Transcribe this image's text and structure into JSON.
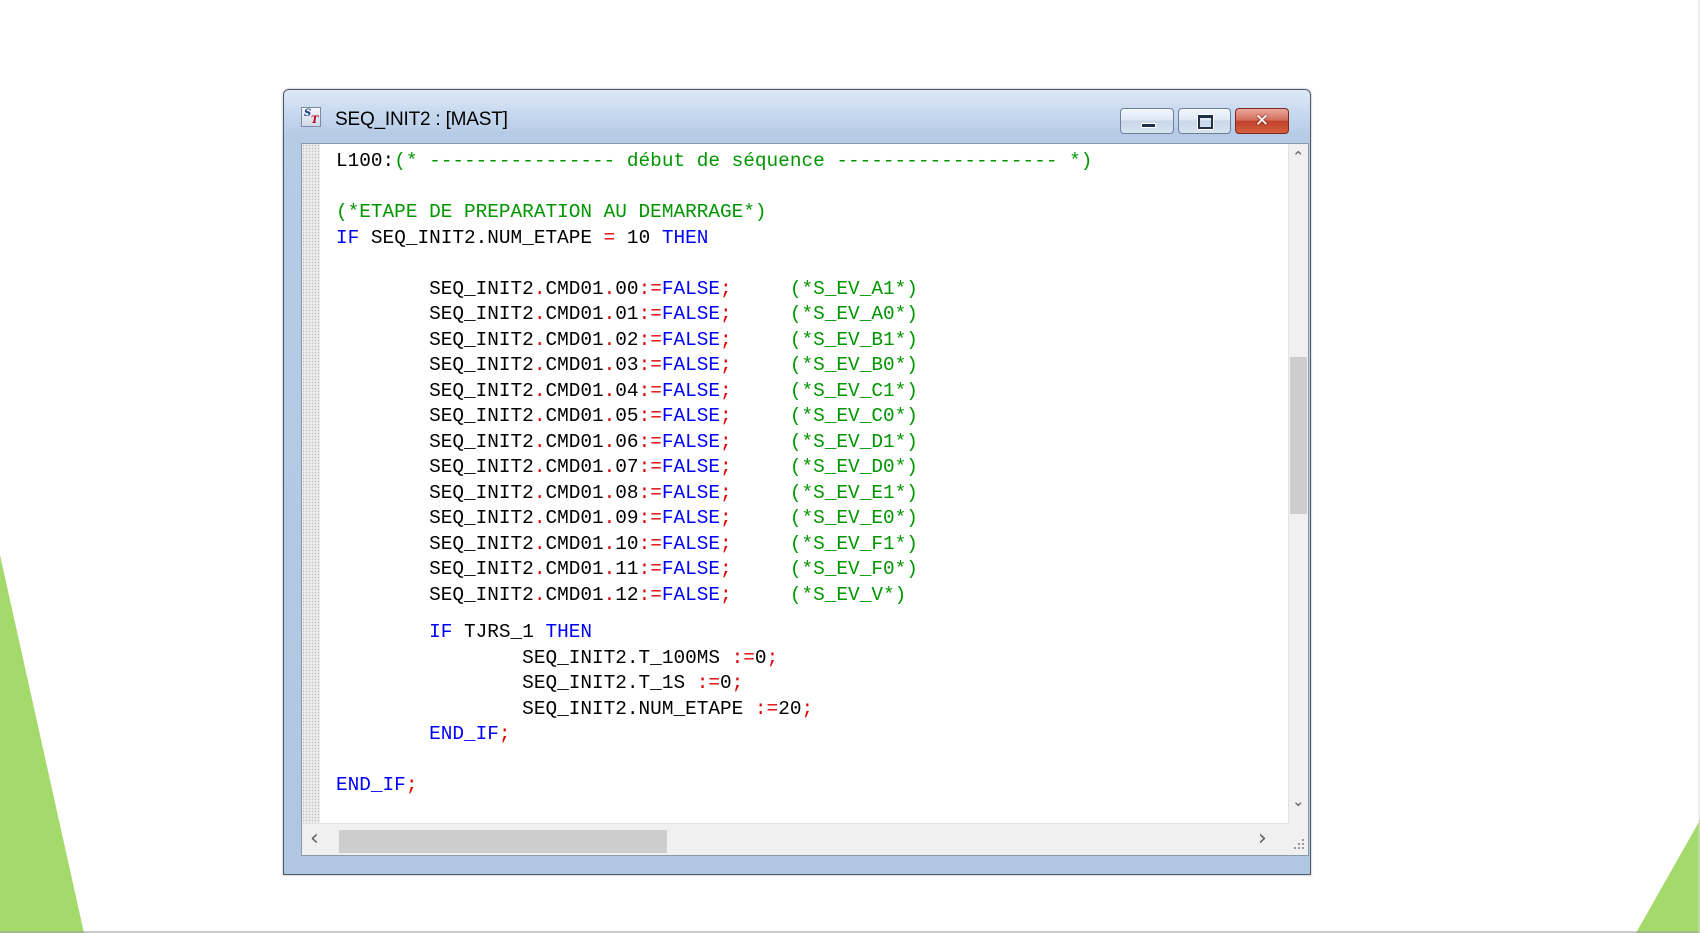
{
  "window": {
    "title": "SEQ_INIT2 : [MAST]",
    "icon": "structured-text-icon",
    "icon_letters": {
      "s": "S",
      "t": "T"
    },
    "controls": {
      "minimize": "minimize-icon",
      "maximize": "maximize-icon",
      "close": "close-icon",
      "close_glyph": "✕"
    }
  },
  "colors": {
    "comment": "#009600",
    "keyword": "#0000ff",
    "operator": "#e00000",
    "slide_accent": "#a4d96b"
  },
  "code": {
    "lines": [
      [
        {
          "t": "L100:",
          "c": ""
        },
        {
          "t": "(* ---------------- début de séquence ------------------- *)",
          "c": "cmt"
        }
      ],
      [],
      [
        {
          "t": "(*ETAPE DE PREPARATION AU DEMARRAGE*)",
          "c": "cmt"
        }
      ],
      [
        {
          "t": "IF",
          "c": "kw"
        },
        {
          "t": " SEQ_INIT2.NUM_ETAPE ",
          "c": ""
        },
        {
          "t": "=",
          "c": "op"
        },
        {
          "t": " 10 ",
          "c": ""
        },
        {
          "t": "THEN",
          "c": "kw"
        }
      ],
      [],
      [
        {
          "t": "        SEQ_INIT2",
          "c": ""
        },
        {
          "t": ".",
          "c": "op"
        },
        {
          "t": "CMD01",
          "c": ""
        },
        {
          "t": ".",
          "c": "op"
        },
        {
          "t": "00",
          "c": ""
        },
        {
          "t": ":=",
          "c": "op"
        },
        {
          "t": "FALSE",
          "c": "kw"
        },
        {
          "t": ";",
          "c": "op"
        },
        {
          "t": "     ",
          "c": ""
        },
        {
          "t": "(*S_EV_A1*)",
          "c": "cmt"
        }
      ],
      [
        {
          "t": "        SEQ_INIT2",
          "c": ""
        },
        {
          "t": ".",
          "c": "op"
        },
        {
          "t": "CMD01",
          "c": ""
        },
        {
          "t": ".",
          "c": "op"
        },
        {
          "t": "01",
          "c": ""
        },
        {
          "t": ":=",
          "c": "op"
        },
        {
          "t": "FALSE",
          "c": "kw"
        },
        {
          "t": ";",
          "c": "op"
        },
        {
          "t": "     ",
          "c": ""
        },
        {
          "t": "(*S_EV_A0*)",
          "c": "cmt"
        }
      ],
      [
        {
          "t": "        SEQ_INIT2",
          "c": ""
        },
        {
          "t": ".",
          "c": "op"
        },
        {
          "t": "CMD01",
          "c": ""
        },
        {
          "t": ".",
          "c": "op"
        },
        {
          "t": "02",
          "c": ""
        },
        {
          "t": ":=",
          "c": "op"
        },
        {
          "t": "FALSE",
          "c": "kw"
        },
        {
          "t": ";",
          "c": "op"
        },
        {
          "t": "     ",
          "c": ""
        },
        {
          "t": "(*S_EV_B1*)",
          "c": "cmt"
        }
      ],
      [
        {
          "t": "        SEQ_INIT2",
          "c": ""
        },
        {
          "t": ".",
          "c": "op"
        },
        {
          "t": "CMD01",
          "c": ""
        },
        {
          "t": ".",
          "c": "op"
        },
        {
          "t": "03",
          "c": ""
        },
        {
          "t": ":=",
          "c": "op"
        },
        {
          "t": "FALSE",
          "c": "kw"
        },
        {
          "t": ";",
          "c": "op"
        },
        {
          "t": "     ",
          "c": ""
        },
        {
          "t": "(*S_EV_B0*)",
          "c": "cmt"
        }
      ],
      [
        {
          "t": "        SEQ_INIT2",
          "c": ""
        },
        {
          "t": ".",
          "c": "op"
        },
        {
          "t": "CMD01",
          "c": ""
        },
        {
          "t": ".",
          "c": "op"
        },
        {
          "t": "04",
          "c": ""
        },
        {
          "t": ":=",
          "c": "op"
        },
        {
          "t": "FALSE",
          "c": "kw"
        },
        {
          "t": ";",
          "c": "op"
        },
        {
          "t": "     ",
          "c": ""
        },
        {
          "t": "(*S_EV_C1*)",
          "c": "cmt"
        }
      ],
      [
        {
          "t": "        SEQ_INIT2",
          "c": ""
        },
        {
          "t": ".",
          "c": "op"
        },
        {
          "t": "CMD01",
          "c": ""
        },
        {
          "t": ".",
          "c": "op"
        },
        {
          "t": "05",
          "c": ""
        },
        {
          "t": ":=",
          "c": "op"
        },
        {
          "t": "FALSE",
          "c": "kw"
        },
        {
          "t": ";",
          "c": "op"
        },
        {
          "t": "     ",
          "c": ""
        },
        {
          "t": "(*S_EV_C0*)",
          "c": "cmt"
        }
      ],
      [
        {
          "t": "        SEQ_INIT2",
          "c": ""
        },
        {
          "t": ".",
          "c": "op"
        },
        {
          "t": "CMD01",
          "c": ""
        },
        {
          "t": ".",
          "c": "op"
        },
        {
          "t": "06",
          "c": ""
        },
        {
          "t": ":=",
          "c": "op"
        },
        {
          "t": "FALSE",
          "c": "kw"
        },
        {
          "t": ";",
          "c": "op"
        },
        {
          "t": "     ",
          "c": ""
        },
        {
          "t": "(*S_EV_D1*)",
          "c": "cmt"
        }
      ],
      [
        {
          "t": "        SEQ_INIT2",
          "c": ""
        },
        {
          "t": ".",
          "c": "op"
        },
        {
          "t": "CMD01",
          "c": ""
        },
        {
          "t": ".",
          "c": "op"
        },
        {
          "t": "07",
          "c": ""
        },
        {
          "t": ":=",
          "c": "op"
        },
        {
          "t": "FALSE",
          "c": "kw"
        },
        {
          "t": ";",
          "c": "op"
        },
        {
          "t": "     ",
          "c": ""
        },
        {
          "t": "(*S_EV_D0*)",
          "c": "cmt"
        }
      ],
      [
        {
          "t": "        SEQ_INIT2",
          "c": ""
        },
        {
          "t": ".",
          "c": "op"
        },
        {
          "t": "CMD01",
          "c": ""
        },
        {
          "t": ".",
          "c": "op"
        },
        {
          "t": "08",
          "c": ""
        },
        {
          "t": ":=",
          "c": "op"
        },
        {
          "t": "FALSE",
          "c": "kw"
        },
        {
          "t": ";",
          "c": "op"
        },
        {
          "t": "     ",
          "c": ""
        },
        {
          "t": "(*S_EV_E1*)",
          "c": "cmt"
        }
      ],
      [
        {
          "t": "        SEQ_INIT2",
          "c": ""
        },
        {
          "t": ".",
          "c": "op"
        },
        {
          "t": "CMD01",
          "c": ""
        },
        {
          "t": ".",
          "c": "op"
        },
        {
          "t": "09",
          "c": ""
        },
        {
          "t": ":=",
          "c": "op"
        },
        {
          "t": "FALSE",
          "c": "kw"
        },
        {
          "t": ";",
          "c": "op"
        },
        {
          "t": "     ",
          "c": ""
        },
        {
          "t": "(*S_EV_E0*)",
          "c": "cmt"
        }
      ],
      [
        {
          "t": "        SEQ_INIT2",
          "c": ""
        },
        {
          "t": ".",
          "c": "op"
        },
        {
          "t": "CMD01",
          "c": ""
        },
        {
          "t": ".",
          "c": "op"
        },
        {
          "t": "10",
          "c": ""
        },
        {
          "t": ":=",
          "c": "op"
        },
        {
          "t": "FALSE",
          "c": "kw"
        },
        {
          "t": ";",
          "c": "op"
        },
        {
          "t": "     ",
          "c": ""
        },
        {
          "t": "(*S_EV_F1*)",
          "c": "cmt"
        }
      ],
      [
        {
          "t": "        SEQ_INIT2",
          "c": ""
        },
        {
          "t": ".",
          "c": "op"
        },
        {
          "t": "CMD01",
          "c": ""
        },
        {
          "t": ".",
          "c": "op"
        },
        {
          "t": "11",
          "c": ""
        },
        {
          "t": ":=",
          "c": "op"
        },
        {
          "t": "FALSE",
          "c": "kw"
        },
        {
          "t": ";",
          "c": "op"
        },
        {
          "t": "     ",
          "c": ""
        },
        {
          "t": "(*S_EV_F0*)",
          "c": "cmt"
        }
      ],
      [
        {
          "t": "        SEQ_INIT2",
          "c": ""
        },
        {
          "t": ".",
          "c": "op"
        },
        {
          "t": "CMD01",
          "c": ""
        },
        {
          "t": ".",
          "c": "op"
        },
        {
          "t": "12",
          "c": ""
        },
        {
          "t": ":=",
          "c": "op"
        },
        {
          "t": "FALSE",
          "c": "kw"
        },
        {
          "t": ";",
          "c": "op"
        },
        {
          "t": "     ",
          "c": ""
        },
        {
          "t": "(*S_EV_V*)",
          "c": "cmt"
        }
      ],
      [
        {
          "t": "        ",
          "c": ""
        },
        {
          "t": "IF",
          "c": "kw"
        },
        {
          "t": " TJRS_1 ",
          "c": ""
        },
        {
          "t": "THEN",
          "c": "kw"
        }
      ],
      [
        {
          "t": "                SEQ_INIT2.T_100MS ",
          "c": ""
        },
        {
          "t": ":=",
          "c": "op"
        },
        {
          "t": "0",
          "c": ""
        },
        {
          "t": ";",
          "c": "op"
        }
      ],
      [
        {
          "t": "                SEQ_INIT2.T_1S ",
          "c": ""
        },
        {
          "t": ":=",
          "c": "op"
        },
        {
          "t": "0",
          "c": ""
        },
        {
          "t": ";",
          "c": "op"
        }
      ],
      [
        {
          "t": "                SEQ_INIT2.NUM_ETAPE ",
          "c": ""
        },
        {
          "t": ":=",
          "c": "op"
        },
        {
          "t": "20",
          "c": ""
        },
        {
          "t": ";",
          "c": "op"
        }
      ],
      [
        {
          "t": "        ",
          "c": ""
        },
        {
          "t": "END_IF",
          "c": "kw"
        },
        {
          "t": ";",
          "c": "op"
        }
      ],
      [],
      [
        {
          "t": "END_IF",
          "c": "kw"
        },
        {
          "t": ";",
          "c": "op"
        }
      ]
    ]
  },
  "scrollbars": {
    "vertical": {
      "up_arrow": "chevron-up-icon",
      "down_arrow": "chevron-down-icon",
      "up_glyph": "⌃",
      "down_glyph": "⌄"
    },
    "horizontal": {
      "left_arrow": "chevron-left-icon",
      "right_arrow": "chevron-right-icon",
      "left_glyph": "‹",
      "right_glyph": "›"
    }
  }
}
